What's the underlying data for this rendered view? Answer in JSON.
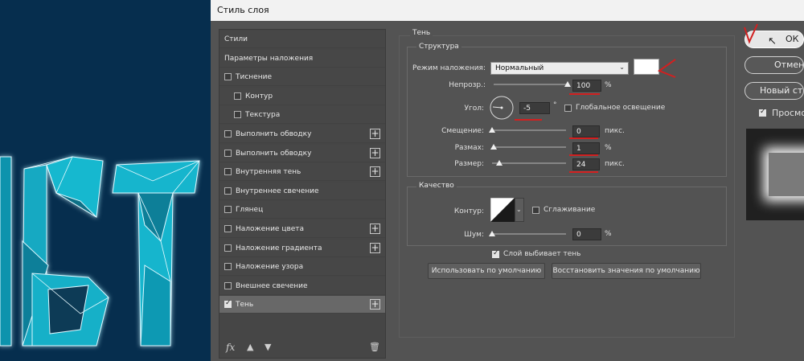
{
  "dialog": {
    "title": "Стиль слоя"
  },
  "styles_list": {
    "items": [
      {
        "label": "Стили",
        "checkbox": false,
        "checked": false,
        "plus": false,
        "indent": 0,
        "active": false
      },
      {
        "label": "Параметры наложения",
        "checkbox": false,
        "checked": false,
        "plus": false,
        "indent": 0,
        "active": false
      },
      {
        "label": "Тиснение",
        "checkbox": true,
        "checked": false,
        "plus": false,
        "indent": 0,
        "active": false
      },
      {
        "label": "Контур",
        "checkbox": true,
        "checked": false,
        "plus": false,
        "indent": 1,
        "active": false
      },
      {
        "label": "Текстура",
        "checkbox": true,
        "checked": false,
        "plus": false,
        "indent": 1,
        "active": false
      },
      {
        "label": "Выполнить обводку",
        "checkbox": true,
        "checked": false,
        "plus": true,
        "indent": 0,
        "active": false
      },
      {
        "label": "Выполнить обводку",
        "checkbox": true,
        "checked": false,
        "plus": true,
        "indent": 0,
        "active": false
      },
      {
        "label": "Внутренняя тень",
        "checkbox": true,
        "checked": false,
        "plus": true,
        "indent": 0,
        "active": false
      },
      {
        "label": "Внутреннее свечение",
        "checkbox": true,
        "checked": false,
        "plus": false,
        "indent": 0,
        "active": false
      },
      {
        "label": "Глянец",
        "checkbox": true,
        "checked": false,
        "plus": false,
        "indent": 0,
        "active": false
      },
      {
        "label": "Наложение цвета",
        "checkbox": true,
        "checked": false,
        "plus": true,
        "indent": 0,
        "active": false
      },
      {
        "label": "Наложение градиента",
        "checkbox": true,
        "checked": false,
        "plus": true,
        "indent": 0,
        "active": false
      },
      {
        "label": "Наложение узора",
        "checkbox": true,
        "checked": false,
        "plus": false,
        "indent": 0,
        "active": false
      },
      {
        "label": "Внешнее свечение",
        "checkbox": true,
        "checked": false,
        "plus": false,
        "indent": 0,
        "active": false
      },
      {
        "label": "Тень",
        "checkbox": true,
        "checked": true,
        "plus": true,
        "indent": 0,
        "active": true
      }
    ],
    "footer_icons": [
      "fx-icon",
      "arrow-up-icon",
      "arrow-down-icon",
      "trash-icon"
    ],
    "fx_label": "fx"
  },
  "shadow": {
    "section_title": "Тень",
    "structure": {
      "title": "Структура",
      "blend_mode_label": "Режим наложения:",
      "blend_mode_value": "Нормальный",
      "shadow_color": "#ffffff",
      "opacity_label": "Непрозр.:",
      "opacity_value": "100",
      "opacity_unit": "%",
      "opacity_level": 1.0,
      "angle_label": "Угол:",
      "angle_value": "-5",
      "angle_unit": "°",
      "global_light_label": "Глобальное освещение",
      "distance_label": "Смещение:",
      "distance_value": "0",
      "distance_unit": "пикс.",
      "spread_label": "Размах:",
      "spread_value": "1",
      "spread_unit": "%",
      "size_label": "Размер:",
      "size_value": "24",
      "size_unit": "пикс.",
      "size_level": 0.1
    },
    "quality": {
      "title": "Качество",
      "contour_label": "Контур:",
      "antialias_label": "Сглаживание",
      "noise_label": "Шум:",
      "noise_value": "0",
      "noise_unit": "%"
    },
    "knockout_label": "Слой выбивает тень",
    "knockout_checked": true,
    "default_button": "Использовать по умолчанию",
    "reset_button": "Восстановить значения по умолчанию"
  },
  "side_buttons": {
    "ok": "ОК",
    "cancel": "Отмена",
    "new_style": "Новый стиль...",
    "preview": "Просмотр",
    "preview_checked": true
  },
  "colors": {
    "canvas_bg": "#062e4e",
    "letters": "#12b4cc",
    "annotation_red": "#d22020"
  }
}
